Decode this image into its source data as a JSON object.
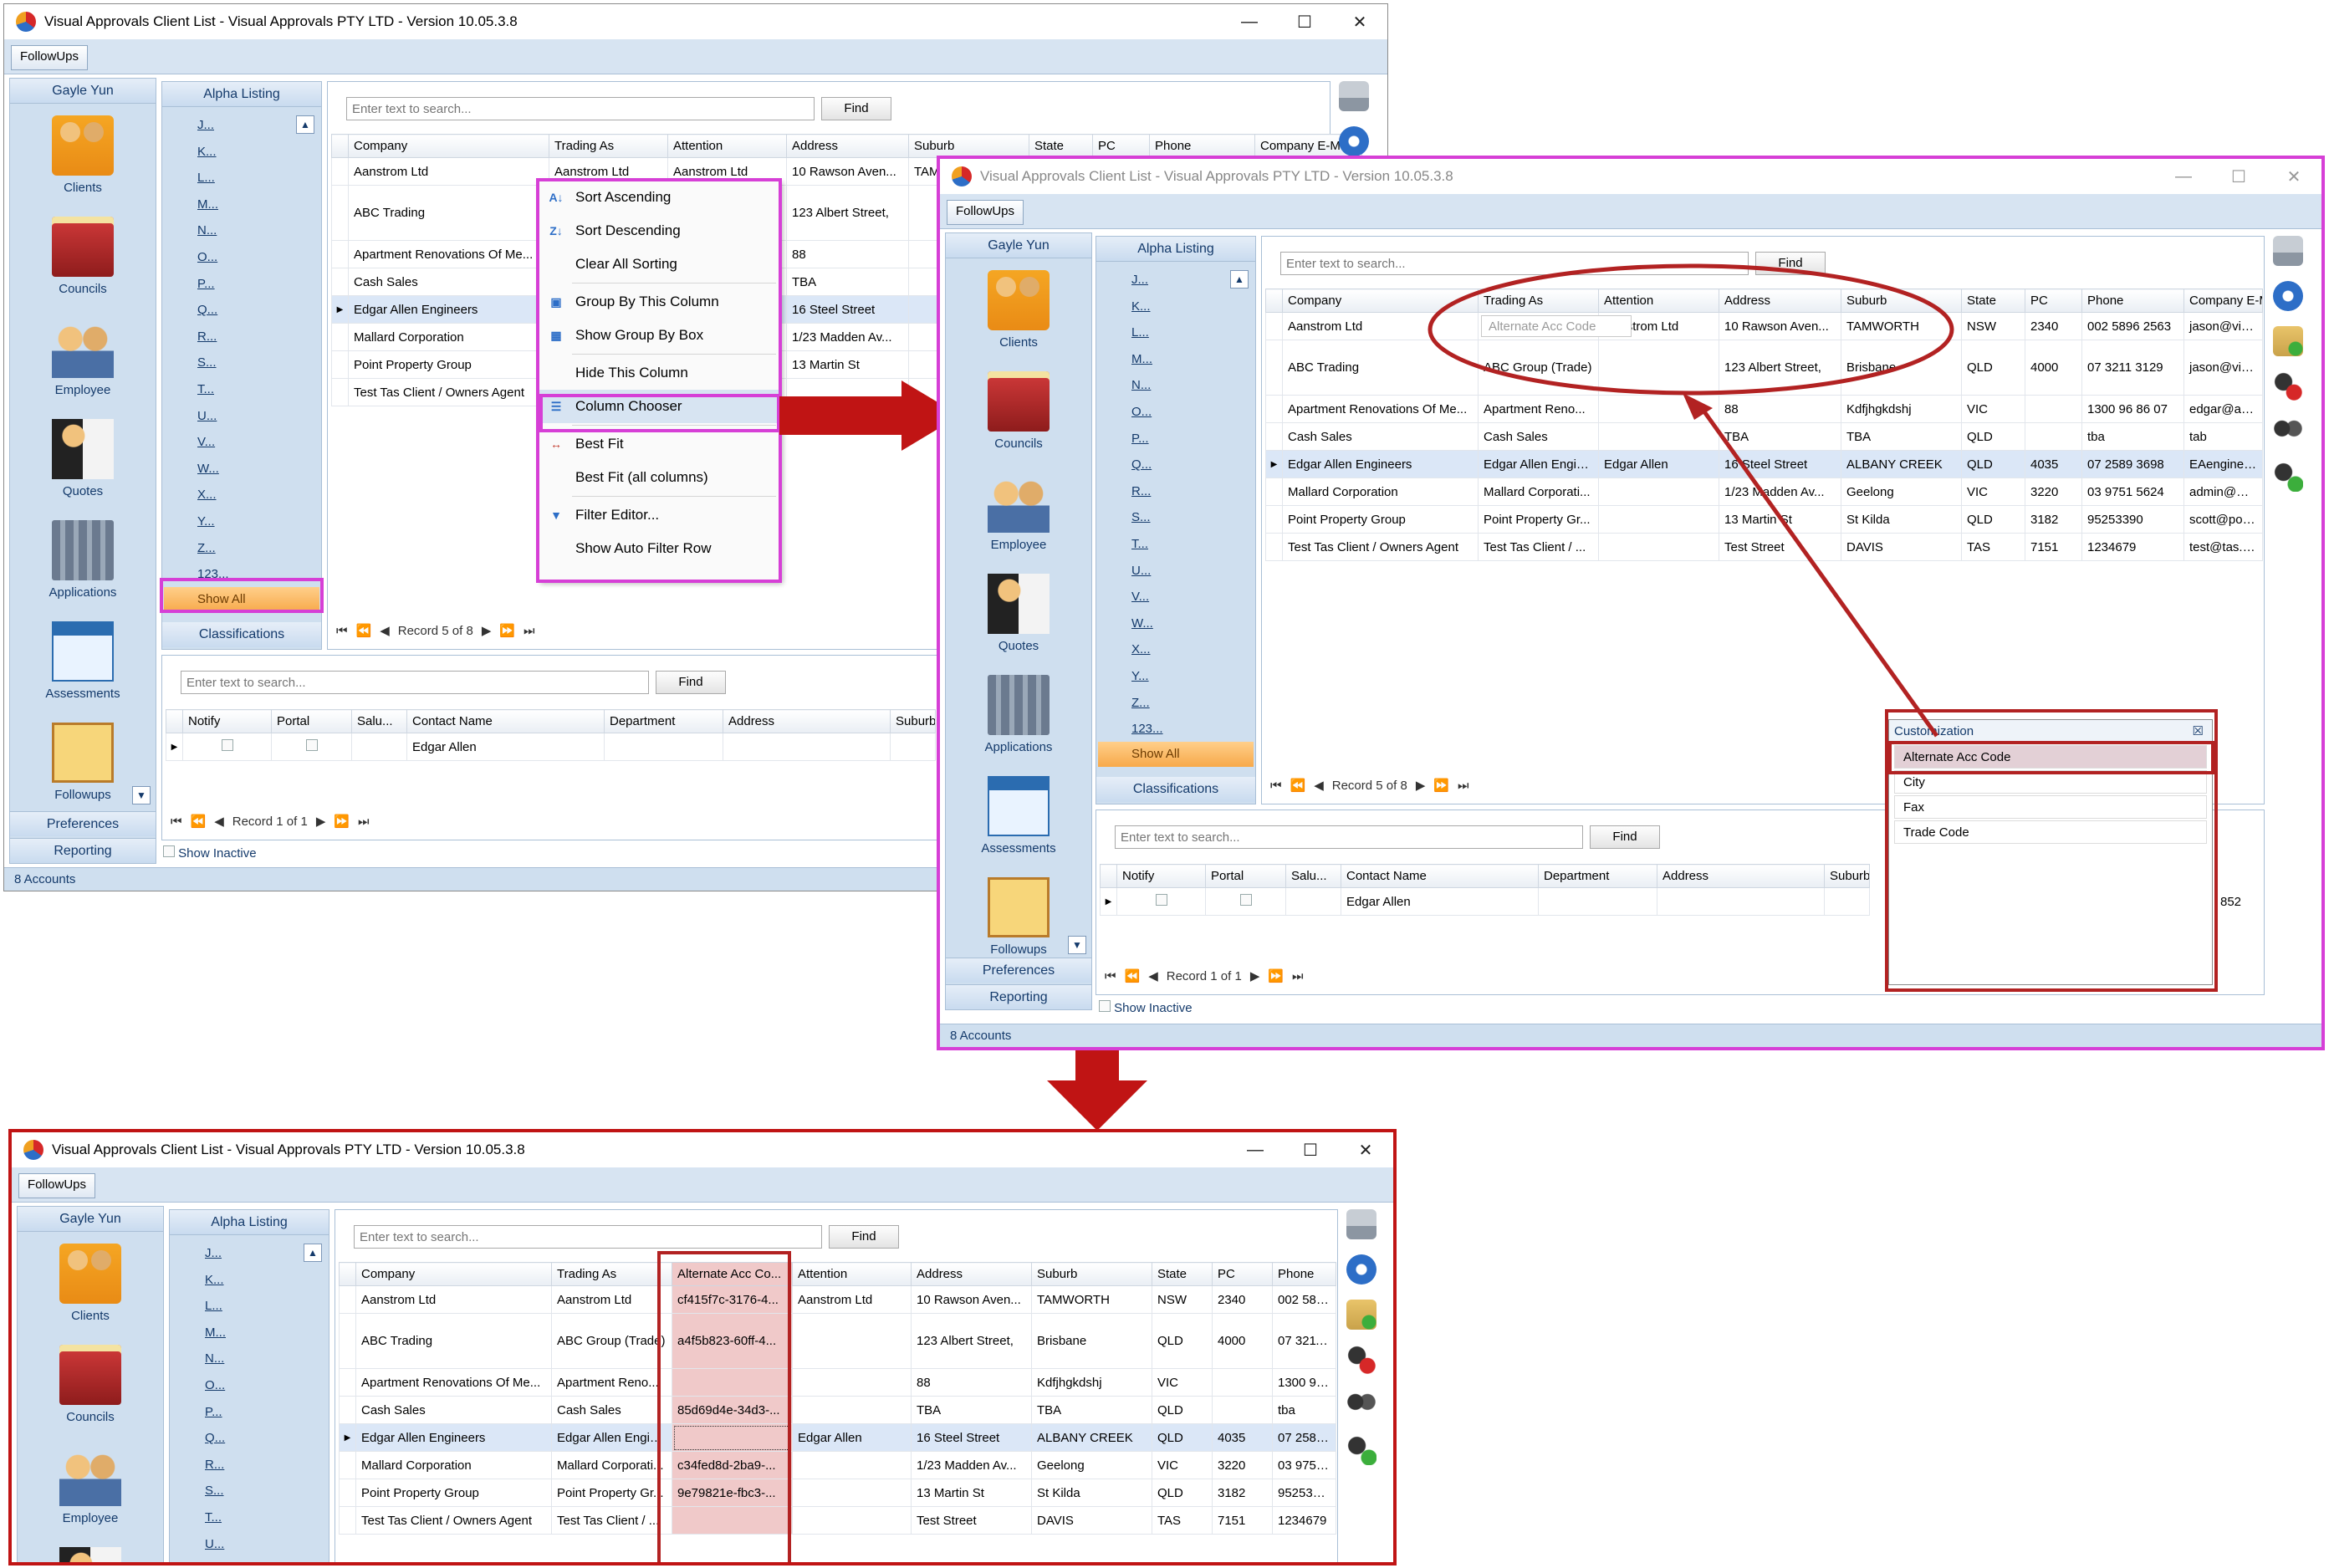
{
  "app": {
    "title": "Visual Approvals Client List - Visual Approvals PTY LTD - Version 10.05.3.8",
    "menu_followups": "FollowUps",
    "win_min": "—",
    "win_max": "☐",
    "win_close": "✕"
  },
  "nav": {
    "user": "Gayle Yun",
    "items": [
      "Clients",
      "Councils",
      "Employee",
      "Quotes",
      "Applications",
      "Assessments",
      "Followups"
    ],
    "preferences": "Preferences",
    "reporting": "Reporting",
    "show_inactive": "Show Inactive",
    "status": "8 Accounts"
  },
  "alpha": {
    "header": "Alpha Listing",
    "letters": [
      "J...",
      "K...",
      "L...",
      "M...",
      "N...",
      "O...",
      "P...",
      "Q...",
      "R...",
      "S...",
      "T...",
      "U...",
      "V...",
      "W...",
      "X...",
      "Y...",
      "Z...",
      "123..."
    ],
    "show_all": "Show All",
    "classifications": "Classifications"
  },
  "search": {
    "placeholder": "Enter text to search...",
    "find": "Find"
  },
  "grid": {
    "headers": [
      "Company",
      "Trading As",
      "Attention",
      "Address",
      "Suburb",
      "State",
      "PC",
      "Phone",
      "Company E-Mail"
    ],
    "rows": [
      [
        "Aanstrom Ltd",
        "Aanstrom Ltd",
        "Aanstrom Ltd",
        "10 Rawson Aven...",
        "TAMWORTH",
        "NSW",
        "2340",
        "002 5896 2563",
        "jason@visuala..."
      ],
      [
        "ABC Trading",
        "ABC Group (Trade)",
        "",
        "123 Albert Street,",
        "Brisbane",
        "QLD",
        "4000",
        "07 3211 3129",
        "jason@visuala..."
      ],
      [
        "Apartment Renovations Of Me...",
        "Apartment Reno...",
        "",
        "88",
        "Kdfjhgkdshj",
        "VIC",
        "",
        "1300 96 86 07",
        "edgar@arom.c..."
      ],
      [
        "Cash Sales",
        "Cash Sales",
        "",
        "TBA",
        "TBA",
        "QLD",
        "",
        "tba",
        "tab"
      ],
      [
        "Edgar Allen Engineers",
        "Edgar Allen Engin...",
        "Edgar Allen",
        "16 Steel Street",
        "ALBANY CREEK",
        "QLD",
        "4035",
        "07 2589 3698",
        "EAengineers@..."
      ],
      [
        "Mallard Corporation",
        "Mallard Corporati...",
        "",
        "1/23 Madden Av...",
        "Geelong",
        "VIC",
        "3220",
        "03 9751 5624",
        "admin@mallar..."
      ],
      [
        "Point Property Group",
        "Point Property Gr...",
        "",
        "13 Martin St",
        "St Kilda",
        "QLD",
        "3182",
        "95253390",
        "scott@pointpr..."
      ],
      [
        "Test Tas Client / Owners Agent",
        "Test Tas Client / ...",
        "",
        "Test Street",
        "DAVIS",
        "TAS",
        "7151",
        "1234679",
        "test@tas.com"
      ]
    ],
    "alt_header": "Alternate Acc Co...",
    "alt_values": [
      "cf415f7c-3176-4...",
      "a4f5b823-60ff-4...",
      "",
      "85d69d4e-34d3-...",
      "",
      "c34fed8d-2ba9-...",
      "9e79821e-fbc3-...",
      ""
    ],
    "record": "Record 5 of 8"
  },
  "contacts": {
    "headers": [
      "Notify",
      "Portal",
      "Salu...",
      "Contact Name",
      "Department",
      "Address",
      "Suburb"
    ],
    "row": [
      "",
      "",
      "",
      "Edgar Allen",
      "",
      "",
      ""
    ],
    "record": "Record 1 of 1",
    "partial_value": "852"
  },
  "context_menu": {
    "items": [
      "Sort Ascending",
      "Sort Descending",
      "Clear All Sorting",
      "Group By This Column",
      "Show Group By Box",
      "Hide This Column",
      "Column Chooser",
      "Best Fit",
      "Best Fit (all columns)",
      "Filter Editor...",
      "Show Auto Filter Row"
    ]
  },
  "customization": {
    "title": "Customization",
    "close": "☒",
    "items": [
      "Alternate Acc Code",
      "City",
      "Fax",
      "Trade Code"
    ],
    "drag_ghost": "Alternate Acc Code"
  },
  "colors": {
    "highlight_magenta": "#d63fd6",
    "highlight_red": "#b22222",
    "arrow_red": "#c01414",
    "selected_row": "#dbe7f7",
    "nav_bg": "#cfdfef"
  }
}
